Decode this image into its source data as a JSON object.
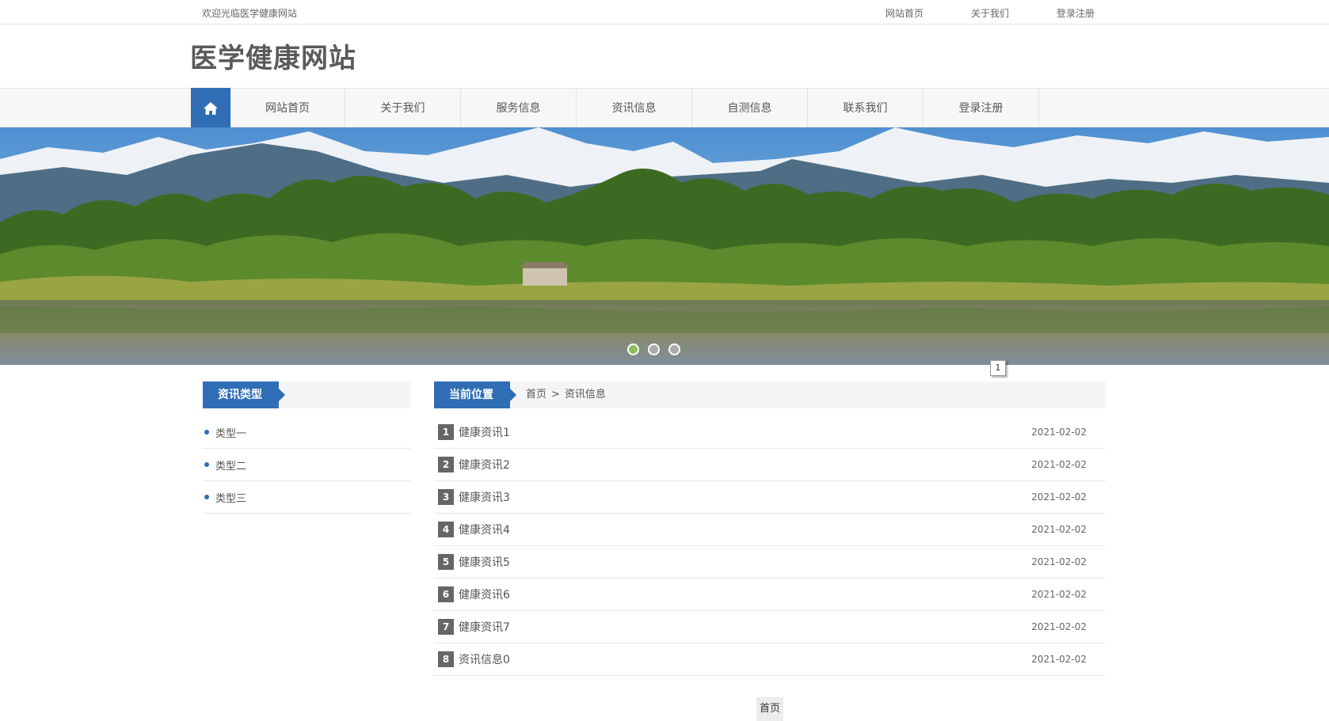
{
  "topbar": {
    "welcome": "欢迎光临医学健康网站",
    "links": [
      "网站首页",
      "关于我们",
      "登录注册"
    ]
  },
  "header": {
    "logo": "医学健康网站"
  },
  "nav": {
    "home_icon": "home-icon",
    "items": [
      "网站首页",
      "关于我们",
      "服务信息",
      "资讯信息",
      "自测信息",
      "联系我们",
      "登录注册"
    ]
  },
  "banner": {
    "page_tag": "1",
    "dots": 3,
    "active_dot": 0
  },
  "sidebar": {
    "title": "资讯类型",
    "items": [
      "类型一",
      "类型二",
      "类型三"
    ]
  },
  "main": {
    "title": "当前位置",
    "breadcrumb": {
      "home": "首页",
      "sep": ">",
      "current": "资讯信息"
    },
    "rows": [
      {
        "num": "1",
        "title": "健康资讯1",
        "date": "2021-02-02"
      },
      {
        "num": "2",
        "title": "健康资讯2",
        "date": "2021-02-02"
      },
      {
        "num": "3",
        "title": "健康资讯3",
        "date": "2021-02-02"
      },
      {
        "num": "4",
        "title": "健康资讯4",
        "date": "2021-02-02"
      },
      {
        "num": "5",
        "title": "健康资讯5",
        "date": "2021-02-02"
      },
      {
        "num": "6",
        "title": "健康资讯6",
        "date": "2021-02-02"
      },
      {
        "num": "7",
        "title": "健康资讯7",
        "date": "2021-02-02"
      },
      {
        "num": "8",
        "title": "资讯信息0",
        "date": "2021-02-02"
      }
    ]
  },
  "pager": {
    "first": "首页"
  },
  "colors": {
    "accent": "#2f6db5",
    "active_dot": "#8dc05a"
  }
}
